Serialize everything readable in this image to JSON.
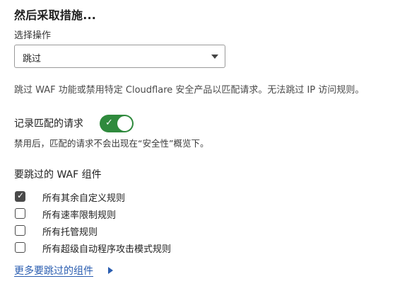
{
  "section": {
    "title": "然后采取措施..."
  },
  "action": {
    "label": "选择操作",
    "selected": "跳过",
    "help": "跳过 WAF 功能或禁用特定 Cloudflare 安全产品以匹配请求。无法跳过 IP 访问规则。"
  },
  "logging": {
    "label": "记录匹配的请求",
    "enabled": true,
    "toggle_glyph": "✓",
    "note": "禁用后，匹配的请求不会出现在“安全性”概览下。"
  },
  "components": {
    "title": "要跳过的 WAF 组件",
    "check_glyph": "✓",
    "items": [
      {
        "label": "所有其余自定义规则",
        "checked": true
      },
      {
        "label": "所有速率限制规则",
        "checked": false
      },
      {
        "label": "所有托管规则",
        "checked": false
      },
      {
        "label": "所有超级自动程序攻击模式规则",
        "checked": false
      }
    ],
    "more_link": "更多要跳过的组件"
  },
  "colors": {
    "toggle_on": "#2f8a3d",
    "link": "#2a5db0",
    "checkbox": "#4a4a4a"
  },
  "icons": {
    "select_caret": "chevron-down-icon",
    "more_arrow": "triangle-right-icon",
    "toggle_check": "checkmark-icon",
    "checkbox_check": "checkmark-icon"
  }
}
